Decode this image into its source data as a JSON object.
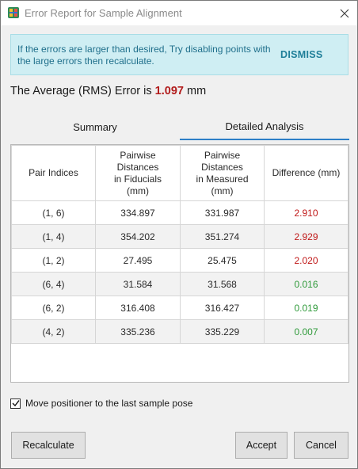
{
  "window": {
    "title": "Error Report for Sample Alignment",
    "icon": "app-icon",
    "close_icon": "close-icon"
  },
  "banner": {
    "message": "If the errors are larger than desired, Try disabling points with the large errors then recalculate.",
    "dismiss_label": "DISMISS",
    "background_color": "#cfeef3",
    "text_color": "#1f6f8b"
  },
  "rms": {
    "prefix": "The Average (RMS) Error is",
    "value": "1.097",
    "unit": "mm",
    "value_color": "#b21c1c"
  },
  "tabs": [
    {
      "label": "Summary",
      "selected": false
    },
    {
      "label": "Detailed Analysis",
      "selected": true
    }
  ],
  "table": {
    "headers": [
      [
        "Pair Indices"
      ],
      [
        "Pairwise",
        "Distances",
        "in Fiducials",
        "(mm)"
      ],
      [
        "Pairwise",
        "Distances",
        "in Measured",
        "(mm)"
      ],
      [
        "Difference (mm)"
      ]
    ],
    "rows": [
      {
        "pair": "(1, 6)",
        "fiducial": "334.897",
        "measured": "331.987",
        "difference": "2.910",
        "status": "bad"
      },
      {
        "pair": "(1, 4)",
        "fiducial": "354.202",
        "measured": "351.274",
        "difference": "2.929",
        "status": "bad"
      },
      {
        "pair": "(1, 2)",
        "fiducial": "27.495",
        "measured": "25.475",
        "difference": "2.020",
        "status": "bad"
      },
      {
        "pair": "(6, 4)",
        "fiducial": "31.584",
        "measured": "31.568",
        "difference": "0.016",
        "status": "ok"
      },
      {
        "pair": "(6, 2)",
        "fiducial": "316.408",
        "measured": "316.427",
        "difference": "0.019",
        "status": "ok"
      },
      {
        "pair": "(4, 2)",
        "fiducial": "335.236",
        "measured": "335.229",
        "difference": "0.007",
        "status": "ok"
      }
    ],
    "status_colors": {
      "bad": "#c01818",
      "ok": "#2f9a3a"
    }
  },
  "options": {
    "move_positioner_label": "Move positioner to the last sample pose",
    "move_positioner_checked": true
  },
  "buttons": {
    "recalculate": "Recalculate",
    "accept": "Accept",
    "cancel": "Cancel"
  }
}
